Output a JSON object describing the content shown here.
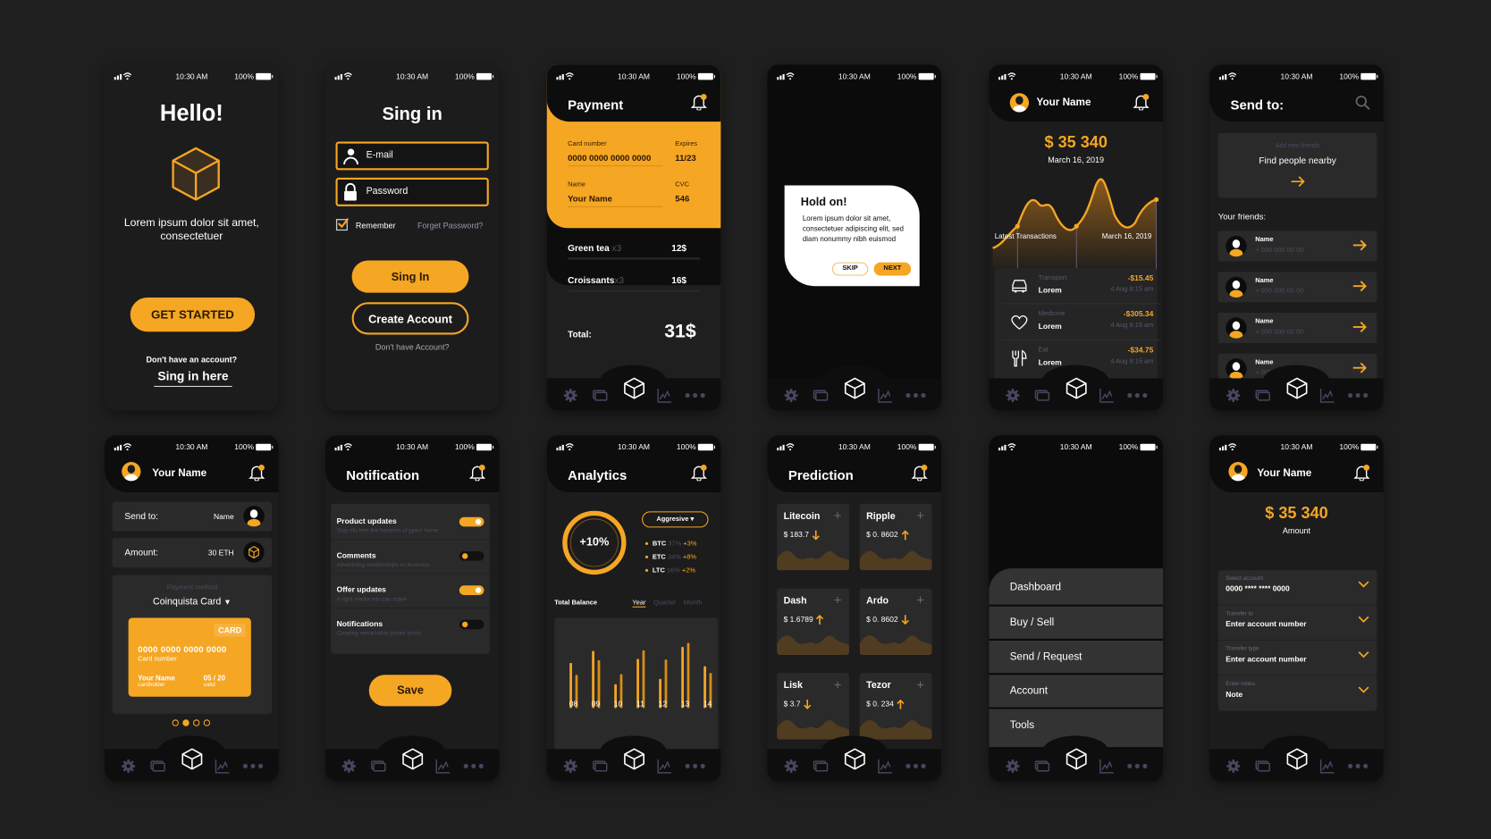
{
  "status": {
    "time": "10:30 AM",
    "battery": "100%"
  },
  "colors": {
    "accent": "#f5a623",
    "background": "#1f1f1f",
    "screen": "#1c1c1c",
    "panel": "#2a2a2a",
    "nav_icon": "#4a4560"
  },
  "nav": {
    "icons": [
      "gear-icon",
      "cards-icon",
      "cube-icon",
      "chart-icon",
      "more-dots-icon"
    ]
  },
  "welcome": {
    "title": "Hello!",
    "text": "Lorem ipsum dolor sit amet, consectetuer",
    "button": "GET STARTED",
    "no_account": "Don't have an account?",
    "signin_link": "Sing in here"
  },
  "signin": {
    "title": "Sing in",
    "email_placeholder": "E-mail",
    "password_placeholder": "Password",
    "remember": "Remember",
    "remember_checked": true,
    "forgot": "Forget Password?",
    "signin_button": "Sing In",
    "create_button": "Create Account",
    "no_account": "Don't have Account?"
  },
  "payment": {
    "title": "Payment",
    "card_number_label": "Card number",
    "card_number": "0000 0000 0000 0000",
    "expires_label": "Expires",
    "expires": "11/23",
    "name_label": "Name",
    "name": "Your Name",
    "cvc_label": "CVC",
    "cvc": "546",
    "items": [
      {
        "name": "Green tea",
        "qty": "x3",
        "price": "12$"
      },
      {
        "name": "Croissants",
        "qty": "x3",
        "price": "16$"
      }
    ],
    "total_label": "Total:",
    "total": "31$"
  },
  "dialog": {
    "title": "Hold on!",
    "text": "Lorem ipsum dolor sit amet, consectetuer adipiscing elit, sed diam nonummy nibh euismod",
    "skip": "SKIP",
    "next": "NEXT"
  },
  "dashboard": {
    "user": "Your Name",
    "balance": "$ 35 340",
    "date": "March 16, 2019",
    "latest": "Latest Transactions",
    "latest_date": "March 16, 2019",
    "transactions": [
      {
        "icon": "car-icon",
        "category": "Transport",
        "name": "Lorem",
        "amount": "-$15.45",
        "time": "4 Aug  8:15 am"
      },
      {
        "icon": "heart-icon",
        "category": "Medicine",
        "name": "Lorem",
        "amount": "-$305.34",
        "time": "4 Aug  8:15 am"
      },
      {
        "icon": "fork-knife-icon",
        "category": "Eat",
        "name": "Lorem",
        "amount": "-$34.75",
        "time": "4 Aug  8:15 am"
      }
    ]
  },
  "send_to": {
    "title": "Send to:",
    "add_label": "Add new friends",
    "find": "Find people nearby",
    "friends_label": "Your friends:",
    "friends": [
      {
        "name": "Name",
        "phone": "+ 000 000 00 00"
      },
      {
        "name": "Name",
        "phone": "+ 000 000 00 00"
      },
      {
        "name": "Name",
        "phone": "+ 000 000 00 00"
      },
      {
        "name": "Name",
        "phone": "+ 000"
      }
    ]
  },
  "send": {
    "user": "Your Name",
    "send_label": "Send to:",
    "recipient": "Name",
    "amount_label": "Amount:",
    "amount": "30 ETH",
    "method_label": "Payment method",
    "method": "Coinquista Card",
    "card_badge": "CARD",
    "card_number": "0000 0000 0000 0000",
    "card_number_label": "Card number",
    "holder": "Your Name",
    "holder_label": "cardholder",
    "valid": "05 / 20",
    "valid_label": "valid",
    "page": 2,
    "pages": 4
  },
  "notification": {
    "title": "Notification",
    "items": [
      {
        "title": "Product updates",
        "desc": "Stay cfo free the freedom of yyour home",
        "on": true
      },
      {
        "title": "Comments",
        "desc": "Advertising relationships vs business",
        "on": false
      },
      {
        "title": "Offer updates",
        "desc": "A right media mix can make",
        "on": true
      },
      {
        "title": "Notifications",
        "desc": "Creating remarkable poster prints",
        "on": false
      }
    ],
    "save": "Save"
  },
  "analytics": {
    "title": "Analytics",
    "change": "+10%",
    "strategy": "Aggresive",
    "coins": [
      {
        "sym": "BTC",
        "share": "37%",
        "change": "+3%"
      },
      {
        "sym": "ETC",
        "share": "34%",
        "change": "+8%"
      },
      {
        "sym": "LTC",
        "share": "16%",
        "change": "+2%"
      }
    ],
    "balance_label": "Total Balance",
    "periods": [
      "Year",
      "Quarter",
      "Month"
    ],
    "active_period": "Year"
  },
  "chart_data": {
    "type": "bar",
    "title": "Total Balance",
    "categories": [
      "08",
      "09",
      "10",
      "11",
      "12",
      "13",
      "14"
    ],
    "series": [
      {
        "values": [
          68,
          86,
          36,
          74,
          44,
          92,
          63
        ]
      },
      {
        "values": [
          50,
          72,
          51,
          87,
          73,
          98,
          53
        ]
      }
    ],
    "ylim": [
      0,
      100
    ],
    "grid": false
  },
  "prediction": {
    "title": "Prediction",
    "coins": [
      {
        "name": "Litecoin",
        "price": "$ 183.7",
        "trend": "down"
      },
      {
        "name": "Ripple",
        "price": "$ 0. 8602",
        "trend": "up"
      },
      {
        "name": "Dash",
        "price": "$ 1.6789",
        "trend": "up"
      },
      {
        "name": "Ardo",
        "price": "$ 0. 8602",
        "trend": "down"
      },
      {
        "name": "Lisk",
        "price": "$ 3.7",
        "trend": "down"
      },
      {
        "name": "Tezor",
        "price": "$ 0. 234",
        "trend": "up"
      }
    ]
  },
  "menu": {
    "items": [
      "Dashboard",
      "Buy / Sell",
      "Send / Request",
      "Account",
      "Tools"
    ]
  },
  "transfer": {
    "user": "Your Name",
    "amount": "$ 35 340",
    "amount_label": "Amount",
    "fields": [
      {
        "label": "Select account",
        "value": "0000 **** **** 0000"
      },
      {
        "label": "Transfer to",
        "value": "Enter account number"
      },
      {
        "label": "Transfer type",
        "value": "Enter account number"
      },
      {
        "label": "Enter notes",
        "value": "Note"
      }
    ]
  }
}
